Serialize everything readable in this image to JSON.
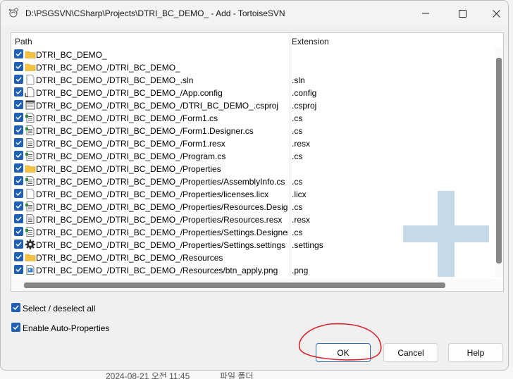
{
  "window": {
    "title": "D:\\PSGSVN\\CSharp\\Projects\\DTRI_BC_DEMO_ - Add - TortoiseSVN",
    "app_icon": "tortoisesvn-icon",
    "controls": {
      "minimize_icon": "minimize-icon",
      "maximize_icon": "maximize-icon",
      "close_icon": "close-icon"
    }
  },
  "list": {
    "columns": {
      "path": "Path",
      "extension": "Extension"
    },
    "rows": [
      {
        "path": "DTRI_BC_DEMO_",
        "ext": "",
        "icon": "folder-icon",
        "checked": true
      },
      {
        "path": "DTRI_BC_DEMO_/DTRI_BC_DEMO_",
        "ext": "",
        "icon": "folder-icon",
        "checked": true
      },
      {
        "path": "DTRI_BC_DEMO_/DTRI_BC_DEMO_.sln",
        "ext": ".sln",
        "icon": "file-icon",
        "checked": true
      },
      {
        "path": "DTRI_BC_DEMO_/DTRI_BC_DEMO_/App.config",
        "ext": ".config",
        "icon": "config-file-icon",
        "checked": true
      },
      {
        "path": "DTRI_BC_DEMO_/DTRI_BC_DEMO_/DTRI_BC_DEMO_.csproj",
        "ext": ".csproj",
        "icon": "project-file-icon",
        "checked": true
      },
      {
        "path": "DTRI_BC_DEMO_/DTRI_BC_DEMO_/Form1.cs",
        "ext": ".cs",
        "icon": "code-file-icon",
        "checked": true
      },
      {
        "path": "DTRI_BC_DEMO_/DTRI_BC_DEMO_/Form1.Designer.cs",
        "ext": ".cs",
        "icon": "code-file-icon",
        "checked": true
      },
      {
        "path": "DTRI_BC_DEMO_/DTRI_BC_DEMO_/Form1.resx",
        "ext": ".resx",
        "icon": "resource-file-icon",
        "checked": true
      },
      {
        "path": "DTRI_BC_DEMO_/DTRI_BC_DEMO_/Program.cs",
        "ext": ".cs",
        "icon": "code-file-icon",
        "checked": true
      },
      {
        "path": "DTRI_BC_DEMO_/DTRI_BC_DEMO_/Properties",
        "ext": "",
        "icon": "folder-icon",
        "checked": true
      },
      {
        "path": "DTRI_BC_DEMO_/DTRI_BC_DEMO_/Properties/AssemblyInfo.cs",
        "ext": ".cs",
        "icon": "code-file-icon",
        "checked": true
      },
      {
        "path": "DTRI_BC_DEMO_/DTRI_BC_DEMO_/Properties/licenses.licx",
        "ext": ".licx",
        "icon": "file-icon",
        "checked": true
      },
      {
        "path": "DTRI_BC_DEMO_/DTRI_BC_DEMO_/Properties/Resources.Designer....",
        "ext": ".cs",
        "icon": "code-file-icon",
        "checked": true
      },
      {
        "path": "DTRI_BC_DEMO_/DTRI_BC_DEMO_/Properties/Resources.resx",
        "ext": ".resx",
        "icon": "resource-file-icon",
        "checked": true
      },
      {
        "path": "DTRI_BC_DEMO_/DTRI_BC_DEMO_/Properties/Settings.Designer.cs",
        "ext": ".cs",
        "icon": "code-file-icon",
        "checked": true
      },
      {
        "path": "DTRI_BC_DEMO_/DTRI_BC_DEMO_/Properties/Settings.settings",
        "ext": ".settings",
        "icon": "settings-gear-icon",
        "checked": true
      },
      {
        "path": "DTRI_BC_DEMO_/DTRI_BC_DEMO_/Resources",
        "ext": "",
        "icon": "folder-icon",
        "checked": true
      },
      {
        "path": "DTRI_BC_DEMO_/DTRI_BC_DEMO_/Resources/btn_apply.png",
        "ext": ".png",
        "icon": "image-file-icon",
        "checked": true
      }
    ],
    "watermark_icon": "add-plus-icon"
  },
  "options": {
    "select_all": "Select / deselect all",
    "select_all_checked": true,
    "auto_props": "Enable Auto-Properties",
    "auto_props_checked": true
  },
  "buttons": {
    "ok": "OK",
    "cancel": "Cancel",
    "help": "Help"
  },
  "background": {
    "date": "2024-08-21 오전 11:45",
    "type": "파일 폴더"
  },
  "colors": {
    "checkbox": "#1f5fb4",
    "folder": "#f5c242",
    "annotation": "#d9232a",
    "watermark": "#c6d9e7"
  }
}
